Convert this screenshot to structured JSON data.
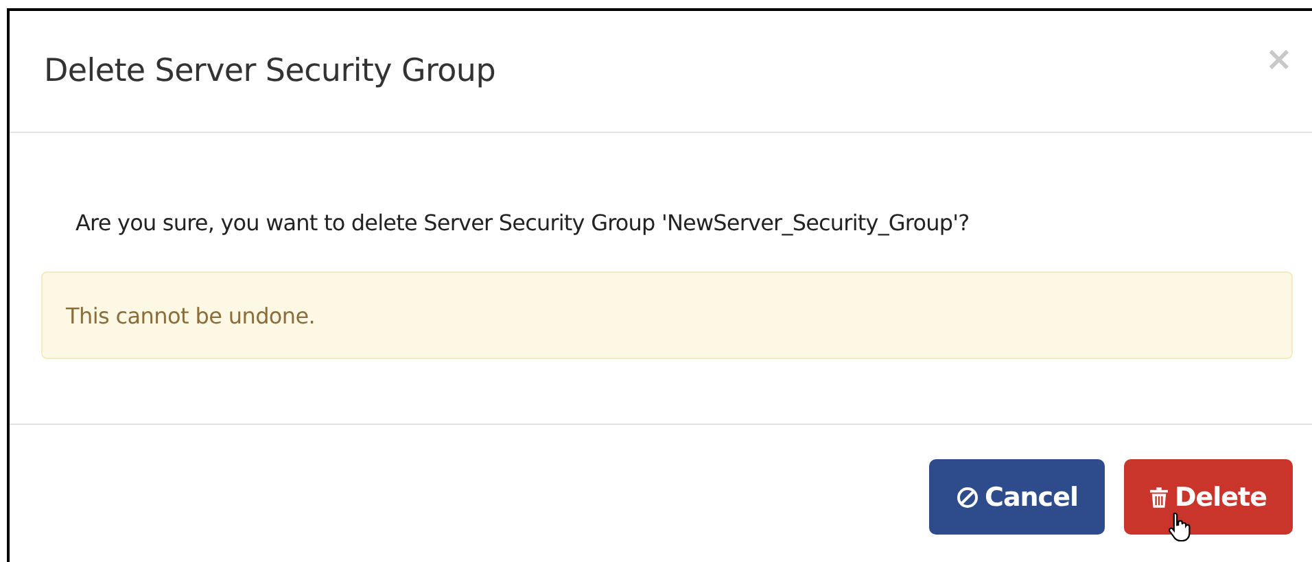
{
  "dialog": {
    "title": "Delete Server Security Group",
    "close": "×"
  },
  "body": {
    "message": "Are you sure, you want to delete Server Security Group 'NewServer_Security_Group'?",
    "warning": "This cannot be undone."
  },
  "buttons": [
    {
      "kind": "cancel",
      "label": "Cancel"
    },
    {
      "kind": "delete",
      "label": "Delete"
    }
  ]
}
